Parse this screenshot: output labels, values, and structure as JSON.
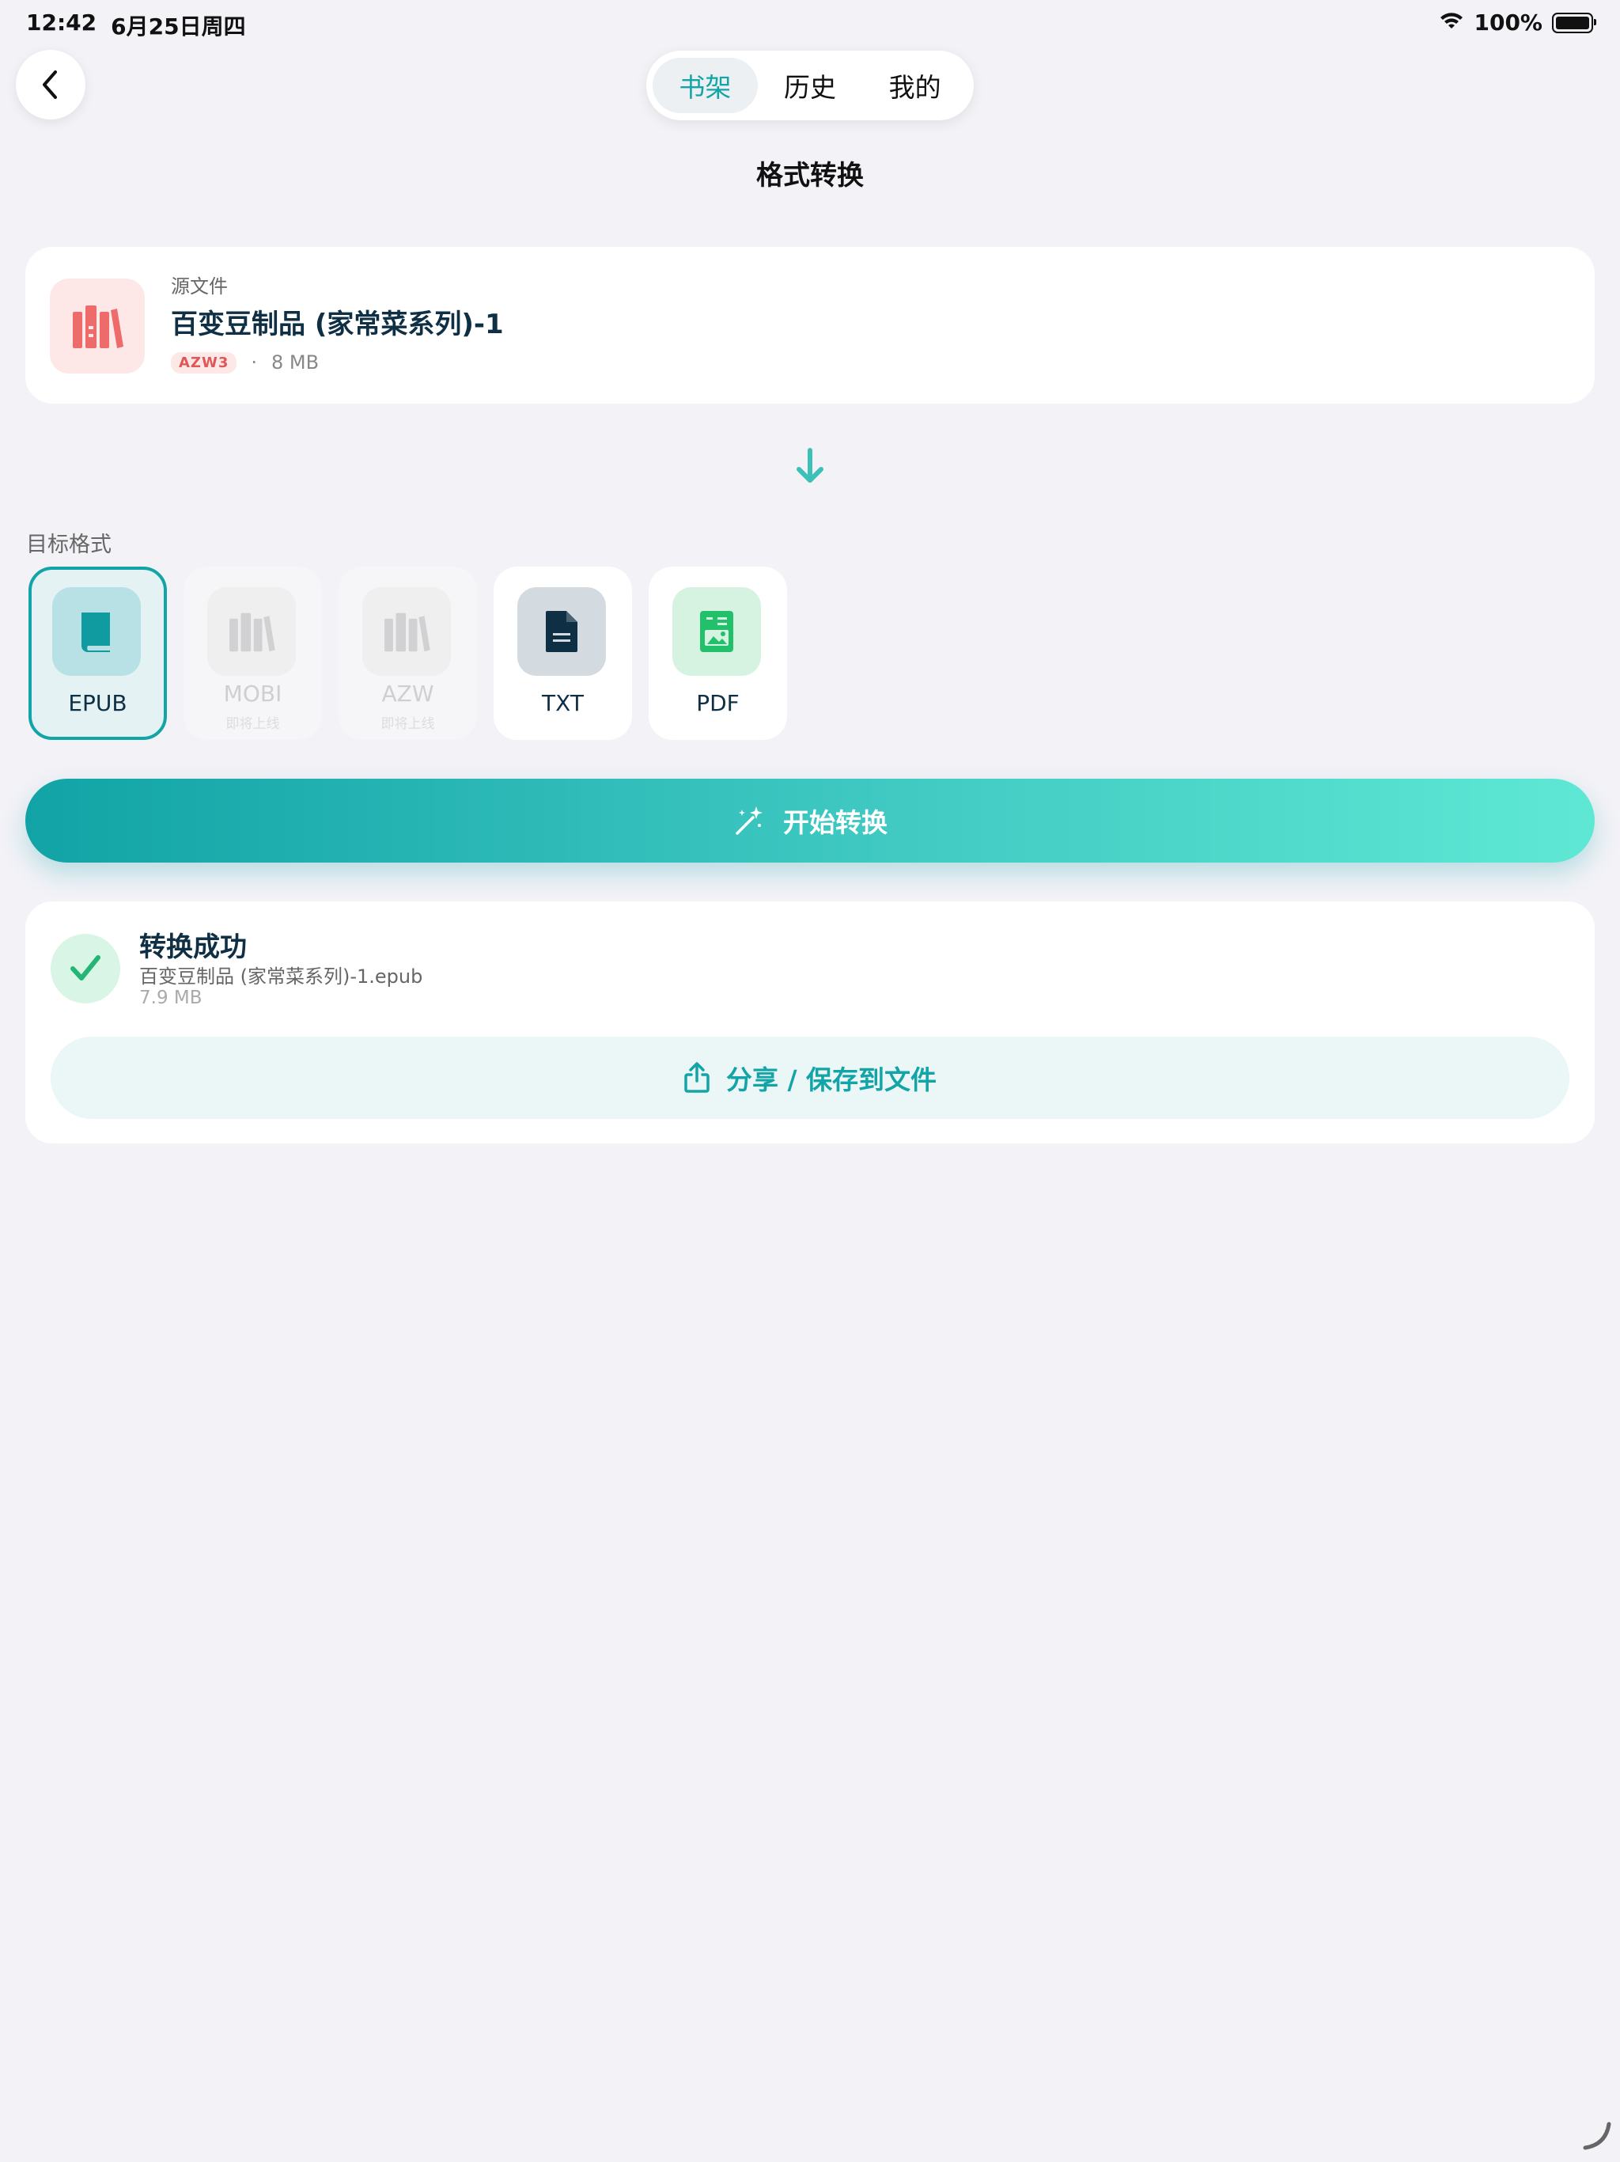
{
  "status_bar": {
    "time": "12:42",
    "date": "6月25日周四",
    "battery": "100%"
  },
  "nav": {
    "back_icon": "chevron-left-icon",
    "tabs": [
      {
        "label": "书架",
        "active": true
      },
      {
        "label": "历史",
        "active": false
      },
      {
        "label": "我的",
        "active": false
      }
    ]
  },
  "page": {
    "title": "格式转换"
  },
  "source": {
    "label": "源文件",
    "name": "百变豆制品 (家常菜系列)-1",
    "format_badge": "AZW3",
    "separator": "·",
    "size": "8 MB",
    "icon": "books-icon"
  },
  "target": {
    "label": "目标格式",
    "options": [
      {
        "name": "EPUB",
        "selected": true,
        "disabled": false,
        "icon": "book-icon"
      },
      {
        "name": "MOBI",
        "selected": false,
        "disabled": true,
        "sub": "即将上线",
        "icon": "books-icon"
      },
      {
        "name": "AZW",
        "selected": false,
        "disabled": true,
        "sub": "即将上线",
        "icon": "books-icon"
      },
      {
        "name": "TXT",
        "selected": false,
        "disabled": false,
        "icon": "document-icon"
      },
      {
        "name": "PDF",
        "selected": false,
        "disabled": false,
        "icon": "pdf-icon"
      }
    ]
  },
  "convert": {
    "label": "开始转换",
    "icon": "magic-wand-icon"
  },
  "result": {
    "title": "转换成功",
    "file_name": "百变豆制品 (家常菜系列)-1.epub",
    "size": "7.9 MB",
    "share_label": "分享 / 保存到文件",
    "icon": "checkmark-icon"
  },
  "colors": {
    "accent": "#12a4a7",
    "background": "#f2f2f7",
    "danger_soft": "#fde8e7",
    "success": "#22b573"
  }
}
